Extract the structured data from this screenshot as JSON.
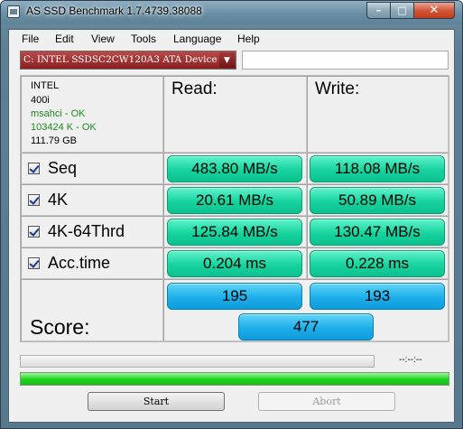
{
  "window": {
    "title": "AS SSD Benchmark 1.7.4739.38088"
  },
  "controls": {
    "minimize": "–",
    "maximize": "□",
    "close": "✕"
  },
  "menu": [
    "File",
    "Edit",
    "View",
    "Tools",
    "Language",
    "Help"
  ],
  "drive": {
    "selected": "C: INTEL SSDSC2CW120A3 ATA Device",
    "dropdown_icon": "▼"
  },
  "info": {
    "vendor": "INTEL",
    "firmware": "400i",
    "driver_status": "msahci - OK",
    "alignment_status": "103424 K - OK",
    "capacity": "111.79 GB",
    "ok_color": "#1e8a1e"
  },
  "headers": {
    "read": "Read:",
    "write": "Write:"
  },
  "tests": [
    {
      "label": "Seq",
      "checked": true,
      "read": "483.80 MB/s",
      "write": "118.08 MB/s"
    },
    {
      "label": "4K",
      "checked": true,
      "read": "20.61 MB/s",
      "write": "50.89 MB/s"
    },
    {
      "label": "4K-64Thrd",
      "checked": true,
      "read": "125.84 MB/s",
      "write": "130.47 MB/s"
    },
    {
      "label": "Acc.time",
      "checked": true,
      "read": "0.204 ms",
      "write": "0.228 ms"
    }
  ],
  "score": {
    "label": "Score:",
    "read": "195",
    "write": "193",
    "total": "477"
  },
  "progress": {
    "time_text": "--:--:--",
    "upper_fraction": 0.0,
    "lower_fraction": 1.0
  },
  "buttons": {
    "start": "Start",
    "abort": "Abort",
    "abort_enabled": false
  },
  "colors": {
    "result_green": "#17d39d",
    "score_blue": "#1eaee8",
    "drive_red": "#8b1f1f"
  }
}
